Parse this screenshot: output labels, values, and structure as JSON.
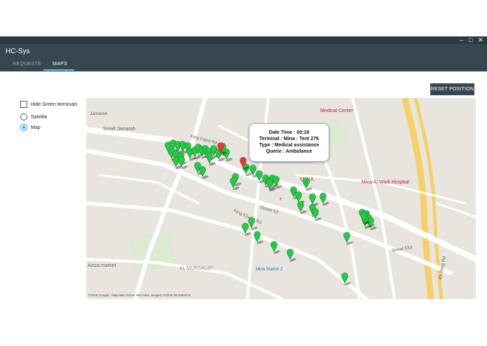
{
  "window": {
    "minimize_icon": "minimize-icon",
    "maximize_icon": "maximize-icon",
    "close_icon": "close-icon"
  },
  "app": {
    "title": "HC-Sys"
  },
  "tabs": [
    {
      "label": "REQUESTE",
      "active": false
    },
    {
      "label": "MAPS",
      "active": true
    }
  ],
  "options": {
    "hide_green_label": "Hide Green terminals",
    "hide_green_checked": false,
    "satelite_label": "Satelite",
    "map_label": "Map",
    "selected": "Map"
  },
  "reset_button": "RESET POSITION",
  "map": {
    "labels": {
      "small_jamarah": "Small Jamarah",
      "jamarah": "Jamarah",
      "medical_center": "Medical Center",
      "mina": "MINA",
      "mina_al_wadi": "Mina Al Wadi Hospital",
      "king_fahd": "King Fahd Rd",
      "king_khalid": "King Khalid Rd",
      "street_53": "Street 53",
      "aziza_market": "Aziza market",
      "al_mursalat": "AL MURSALAT",
      "mina_station": "Mina Station 2",
      "street_533": "Street 533",
      "ring_rd": "4th Ring Rd",
      "attribution": "©2018 Google - Map data ©2018 Tele Atlas, Imagery ©2018 TerraMetrics"
    },
    "colors": {
      "green_marker": "#22cc44",
      "red_marker": "#e53935",
      "road": "#ffffff",
      "base": "#e8e5df",
      "highway": "#f6cf65"
    },
    "markers": {
      "green_count": 54,
      "red_count": 2
    }
  },
  "tooltip": {
    "line1": "Date Time : 00:18",
    "line2": "Terminal : Mina - Tent 276",
    "line3": "Type : Medical assistance",
    "line4": "Querie : Ambulance"
  }
}
